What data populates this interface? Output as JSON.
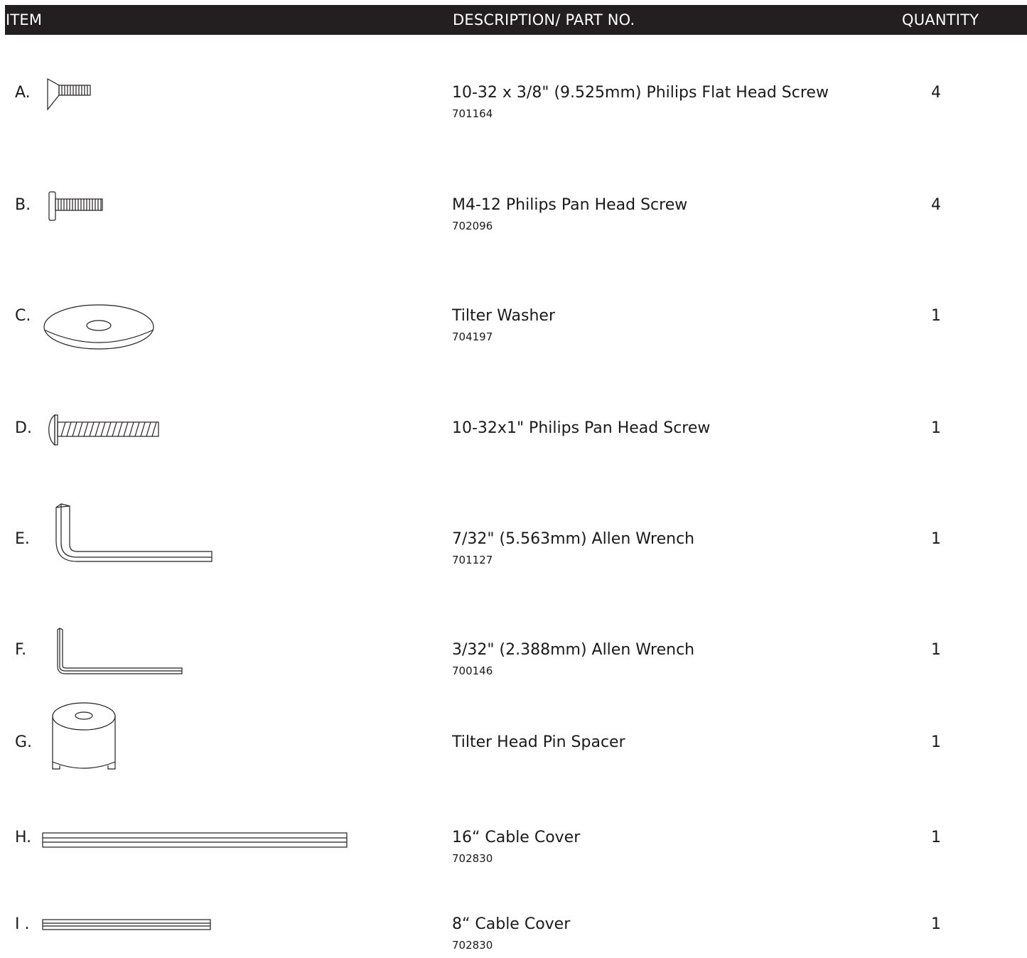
{
  "header": {
    "item": "ITEM",
    "description": "DESCRIPTION/ PART NO.",
    "quantity": "QUANTITY"
  },
  "parts": [
    {
      "letter": "A.",
      "description": "10-32 x 3/8\" (9.525mm) Philips Flat Head Screw",
      "part_no": "701164",
      "quantity": "4",
      "icon": "flat-head-screw-icon"
    },
    {
      "letter": "B.",
      "description": "M4-12 Philips Pan Head Screw",
      "part_no": "702096",
      "quantity": "4",
      "icon": "pan-head-screw-icon"
    },
    {
      "letter": "C.",
      "description": "Tilter Washer",
      "part_no": "704197",
      "quantity": "1",
      "icon": "washer-icon"
    },
    {
      "letter": "D.",
      "description": "10-32x1\" Philips Pan Head Screw",
      "part_no": "",
      "quantity": "1",
      "icon": "long-pan-head-screw-icon"
    },
    {
      "letter": "E.",
      "description": "7/32\" (5.563mm) Allen Wrench",
      "part_no": "701127",
      "quantity": "1",
      "icon": "large-allen-wrench-icon"
    },
    {
      "letter": "F.",
      "description": "3/32\" (2.388mm) Allen Wrench",
      "part_no": "700146",
      "quantity": "1",
      "icon": "small-allen-wrench-icon"
    },
    {
      "letter": "G.",
      "description": "Tilter Head Pin Spacer",
      "part_no": "",
      "quantity": "1",
      "icon": "pin-spacer-icon"
    },
    {
      "letter": "H.",
      "description": "16“ Cable Cover",
      "part_no": "702830",
      "quantity": "1",
      "icon": "long-cable-cover-icon"
    },
    {
      "letter": "I .",
      "description": "8“ Cable Cover",
      "part_no": "702830",
      "quantity": "1",
      "icon": "short-cable-cover-icon"
    }
  ]
}
